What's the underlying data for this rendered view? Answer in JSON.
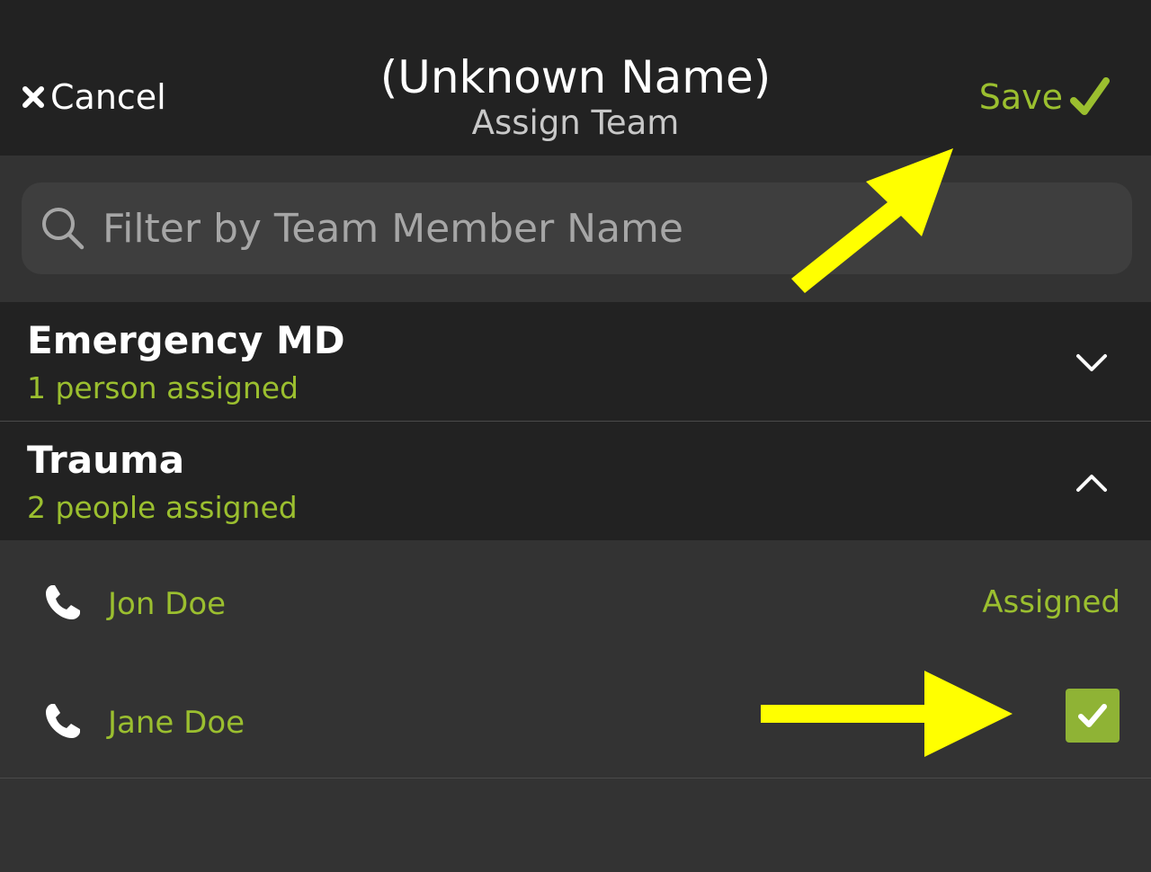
{
  "nav": {
    "cancel_label": "Cancel",
    "title": "(Unknown Name)",
    "subtitle": "Assign Team",
    "save_label": "Save"
  },
  "search": {
    "placeholder": "Filter by Team Member Name",
    "value": ""
  },
  "groups": [
    {
      "name": "Emergency MD",
      "count_label": "1 person assigned",
      "expanded": false
    },
    {
      "name": "Trauma",
      "count_label": "2 people assigned",
      "expanded": true
    }
  ],
  "members": [
    {
      "name": "Jon Doe",
      "status": "Assigned",
      "checked": false
    },
    {
      "name": "Jane Doe",
      "status": "",
      "checked": true
    }
  ],
  "colors": {
    "accent": "#9bbf2f",
    "nav_bg": "#222222",
    "page_bg": "#333333",
    "annotation_arrow": "#ffff00"
  },
  "icons": [
    "close-icon",
    "checkmark-icon",
    "search-icon",
    "chevron-down-icon",
    "chevron-up-icon",
    "phone-icon",
    "checkbox-checked-icon",
    "arrow-annotation"
  ]
}
